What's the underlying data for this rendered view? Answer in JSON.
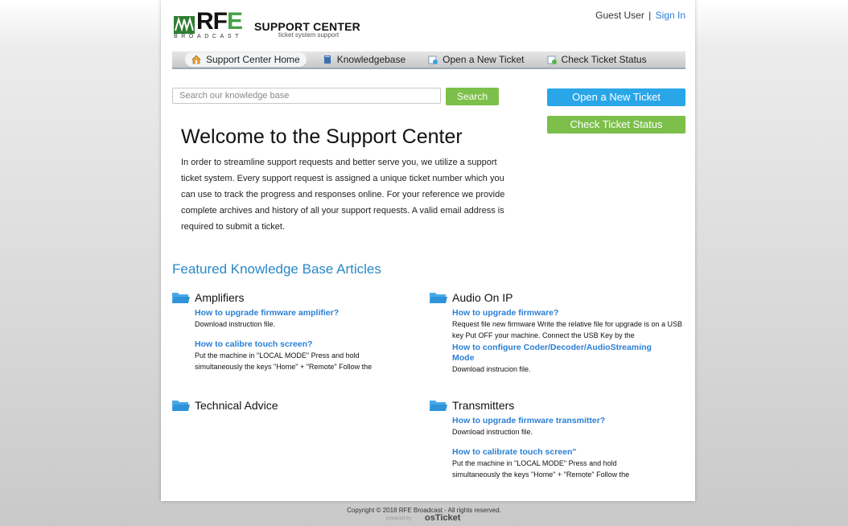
{
  "header": {
    "logo_text_rf": "RF",
    "logo_text_e": "E",
    "broadcast": "BROADCAST",
    "title": "SUPPORT CENTER",
    "subtitle": "ticket system support",
    "user": "Guest User",
    "separator": "|",
    "sign_in": "Sign In"
  },
  "nav": {
    "items": [
      {
        "label": "Support Center Home",
        "icon": "home-icon"
      },
      {
        "label": "Knowledgebase",
        "icon": "book-icon"
      },
      {
        "label": "Open a New Ticket",
        "icon": "new-ticket-icon"
      },
      {
        "label": "Check Ticket Status",
        "icon": "ticket-status-icon"
      }
    ]
  },
  "search": {
    "placeholder": "Search our knowledge base",
    "button": "Search"
  },
  "side_buttons": {
    "open": "Open a New Ticket",
    "check": "Check Ticket Status"
  },
  "welcome": {
    "title": "Welcome to the Support Center",
    "text": "In order to streamline support requests and better serve you, we utilize a support ticket system. Every support request is assigned a unique ticket number which you can use to track the progress and responses online. For your reference we provide complete archives and history of all your support requests. A valid email address is required to submit a ticket."
  },
  "featured_title": "Featured Knowledge Base Articles",
  "categories": [
    {
      "name": "Amplifiers",
      "articles": [
        {
          "title": "How to upgrade firmware amplifier?",
          "desc": "Download instruction file."
        },
        {
          "title": "How to calibre touch screen?",
          "desc": "Put the machine in \"LOCAL MODE\" Press and hold simultaneously the keys \"Home\" + \"Remote\" Follow the"
        }
      ]
    },
    {
      "name": "Technical Advice",
      "articles": []
    },
    {
      "name": "Audio On IP",
      "articles": [
        {
          "title": "How to upgrade firmware?",
          "desc": "Request file new firmware Write the relative file for upgrade is on a USB key Put OFF your machine. Connect the USB Key by the"
        },
        {
          "title": "How to configure Coder/Decoder/AudioStreaming Mode",
          "desc": "Download instrucion file."
        }
      ]
    },
    {
      "name": "Transmitters",
      "articles": [
        {
          "title": "How to upgrade firmware transmitter?",
          "desc": "Download instruction file."
        },
        {
          "title": "How to calibrate touch screen\"",
          "desc": "Put the machine in \"LOCAL MODE\" Press and hold simultaneously the keys \"Home\" + \"Remote\" Follow the"
        }
      ]
    }
  ],
  "footer": {
    "copyright": "Copyright © 2018 RFE Broadcast - All rights reserved.",
    "powered_by": "powered by",
    "osticket": "osTicket"
  },
  "colors": {
    "accent_blue": "#29a6e8",
    "accent_green": "#7cbf4a",
    "link_blue": "#2a7fd4"
  }
}
